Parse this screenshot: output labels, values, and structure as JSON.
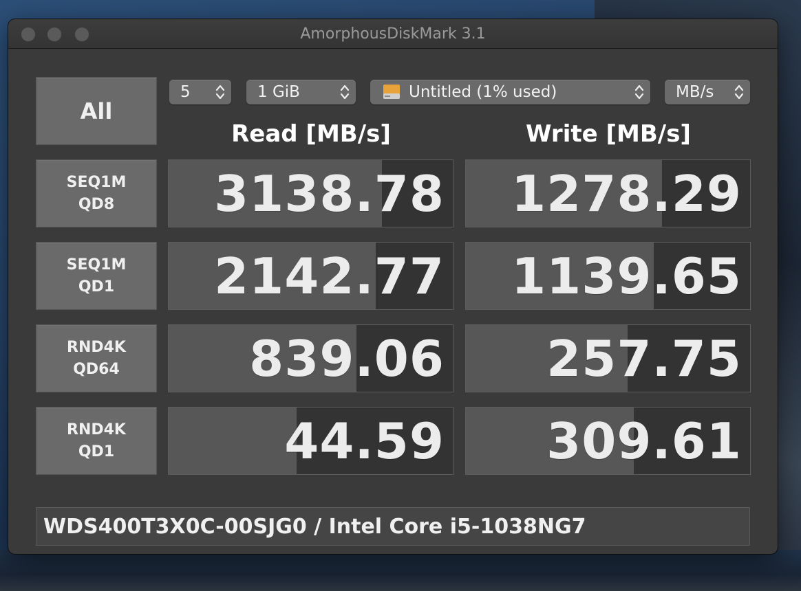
{
  "window": {
    "title": "AmorphousDiskMark 3.1"
  },
  "toolbar": {
    "all_label": "All",
    "count": "5",
    "size": "1 GiB",
    "drive": "Untitled (1% used)",
    "unit": "MB/s"
  },
  "headers": {
    "read": "Read [MB/s]",
    "write": "Write [MB/s]"
  },
  "rows": [
    {
      "label_line1": "SEQ1M",
      "label_line2": "QD8",
      "read": "3138.78",
      "write": "1278.29",
      "read_fill": 0.75,
      "write_fill": 0.69
    },
    {
      "label_line1": "SEQ1M",
      "label_line2": "QD1",
      "read": "2142.77",
      "write": "1139.65",
      "read_fill": 0.73,
      "write_fill": 0.66
    },
    {
      "label_line1": "RND4K",
      "label_line2": "QD64",
      "read": "839.06",
      "write": "257.75",
      "read_fill": 0.66,
      "write_fill": 0.57
    },
    {
      "label_line1": "RND4K",
      "label_line2": "QD1",
      "read": "44.59",
      "write": "309.61",
      "read_fill": 0.45,
      "write_fill": 0.59
    }
  ],
  "footer": {
    "info": "WDS400T3X0C-00SJG0 / Intel Core i5-1038NG7"
  },
  "colors": {
    "window_bg": "#3a3a3a",
    "button_bg": "#6a6a6a",
    "bar_fill": "#575757",
    "bar_bg": "#333333"
  }
}
